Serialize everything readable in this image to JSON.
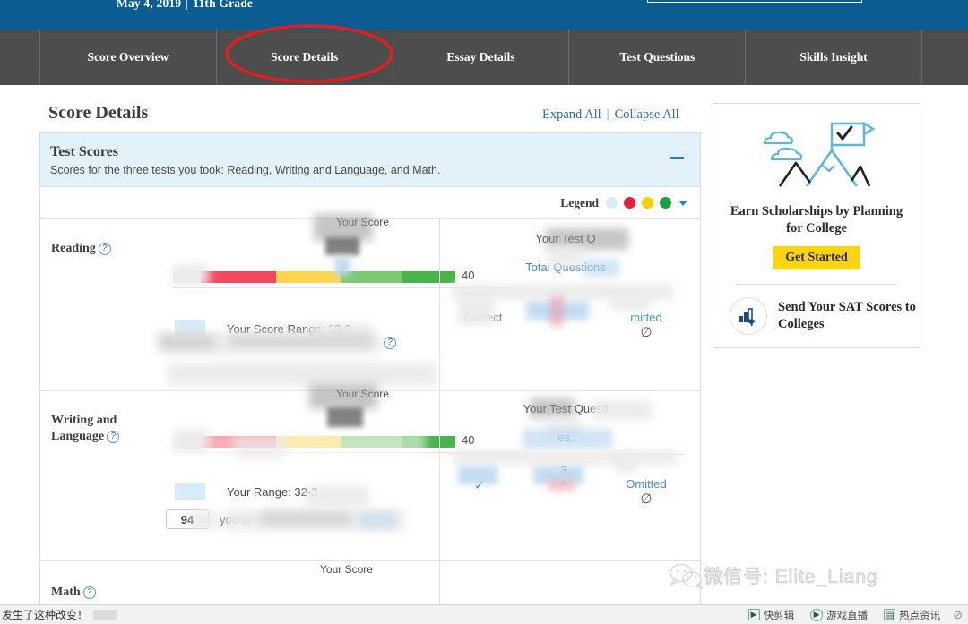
{
  "header": {
    "date": "May 4, 2019",
    "separator": "|",
    "grade": "11th Grade",
    "cta_label": ""
  },
  "tabs": [
    {
      "label": "Score Overview",
      "active": false
    },
    {
      "label": "Score Details",
      "active": true
    },
    {
      "label": "Essay Details",
      "active": false
    },
    {
      "label": "Test Questions",
      "active": false
    },
    {
      "label": "Skills Insight",
      "active": false
    }
  ],
  "annotation": {
    "shape": "red-ellipse",
    "target": "Score Details",
    "color": "#e02020"
  },
  "page": {
    "title": "Score Details",
    "expand_all": "Expand All",
    "divider": "|",
    "collapse_all": "Collapse All"
  },
  "test_scores_card": {
    "title": "Test Scores",
    "subtitle": "Scores for the three tests you took: Reading, Writing and Language, and Math.",
    "collapse_icon": "minus-icon",
    "legend": {
      "label": "Legend",
      "dots": [
        "#d7ebf8",
        "#ed1c3c",
        "#fad000",
        "#1a9e3e"
      ],
      "caret": "chevron-down-icon"
    },
    "rows": [
      {
        "subject": "Reading",
        "help_icon": "question-mark-icon",
        "your_score_caption": "Your Score",
        "scale_max": "40",
        "range_text": "Your Score Range: 33-3",
        "percentile_value": "",
        "percentile_text": "",
        "right": {
          "title": "Your Test Q",
          "subtitle": "Total Questions",
          "columns": [
            {
              "label": "Correct",
              "value": "",
              "icon": "check-icon"
            },
            {
              "label": "",
              "value": "",
              "icon": "caret-icon"
            },
            {
              "label": "mitted",
              "value": "",
              "icon": "omitted-icon"
            }
          ]
        }
      },
      {
        "subject": "Writing and Language",
        "help_icon": "question-mark-icon",
        "your_score_caption": "Your Score",
        "scale_max": "40",
        "range_text": "Your        Range: 32-3",
        "percentile_value": "94",
        "percentile_text": "you ar",
        "right": {
          "title": "Your Test Questi",
          "subtitle": "es.",
          "columns": [
            {
              "label": "",
              "value": "",
              "icon": "check-icon"
            },
            {
              "label": "",
              "value": "3",
              "icon": "caret-icon"
            },
            {
              "label": "Omitted",
              "value": "",
              "icon": "omitted-icon"
            }
          ]
        }
      }
    ],
    "math_row": {
      "subject": "Math",
      "help_icon": "question-mark-icon",
      "your_score_caption": "Your Score"
    }
  },
  "promo": {
    "illustration": "mountain-flag-icon",
    "headline": "Earn Scholarships by Planning for College",
    "button_label": "Get Started",
    "link_icon": "send-scores-icon",
    "link_label": "Send Your SAT Scores to Colleges"
  },
  "watermark": {
    "icon": "wechat-icon",
    "text": "微信号: Elite_Liang"
  },
  "taskbar": {
    "left_link": "发生了这种改变！",
    "items": [
      {
        "icon": "play-square-icon",
        "label": "快剪辑"
      },
      {
        "icon": "play-circle-icon",
        "label": "游戏直播"
      },
      {
        "icon": "news-icon",
        "label": "热点资讯"
      }
    ],
    "trailing_icon": "mute-icon"
  }
}
